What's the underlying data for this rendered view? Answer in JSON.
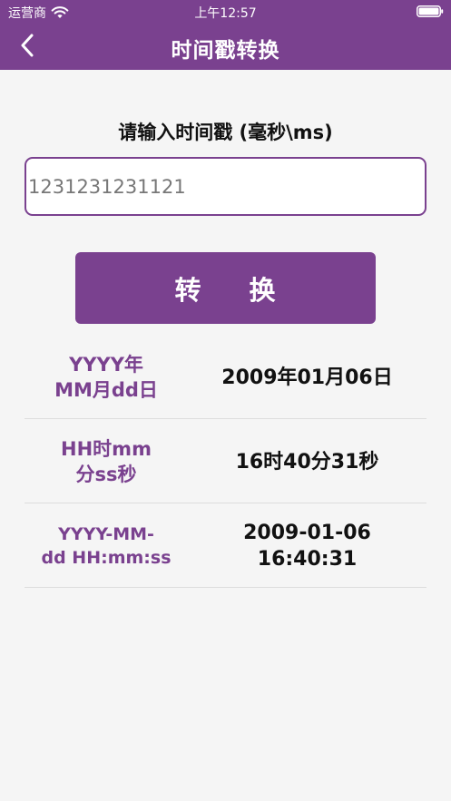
{
  "status_bar": {
    "carrier": "运营商",
    "time": "上午12:57",
    "icons": [
      "wifi-icon",
      "battery-icon"
    ]
  },
  "nav": {
    "title": "时间戳转换",
    "back_icon": "chevron-left-icon"
  },
  "input_label": "请输入时间戳 (毫秒\\ms)",
  "timestamp_input": {
    "value": "",
    "placeholder": "1231231231121"
  },
  "convert_button": {
    "char1": "转",
    "char2": "换"
  },
  "results": [
    {
      "label_line1": "YYYY年",
      "label_line2": "MM月dd日",
      "value_line1": "2009年01月06日",
      "value_line2": ""
    },
    {
      "label_line1": "HH时mm",
      "label_line2": "分ss秒",
      "value_line1": "16时40分31秒",
      "value_line2": ""
    },
    {
      "label_line1": "YYYY-MM-",
      "label_line2": "dd HH:mm:ss",
      "value_line1": "2009-01-06",
      "value_line2": "16:40:31"
    }
  ],
  "colors": {
    "primary": "#7a418f",
    "background": "#f5f5f5",
    "text": "#111111",
    "divider": "#dddddd"
  }
}
